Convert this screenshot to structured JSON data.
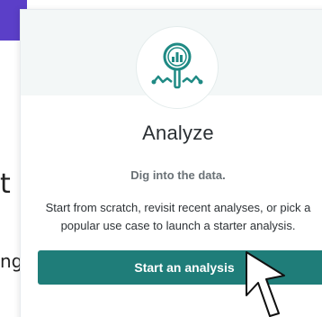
{
  "background": {
    "fragment_t": "t",
    "fragment_ng": "ng"
  },
  "card": {
    "icon": "magnifier-chart-icon",
    "title": "Analyze",
    "subtitle": "Dig into the data.",
    "description": "Start from scratch, revisit recent analyses, or pick a popular use case to launch a starter analysis.",
    "button_label": "Start an analysis"
  },
  "colors": {
    "accent_purple": "#5b3fc8",
    "teal": "#1f7d79",
    "icon_teal": "#1f8a84"
  }
}
